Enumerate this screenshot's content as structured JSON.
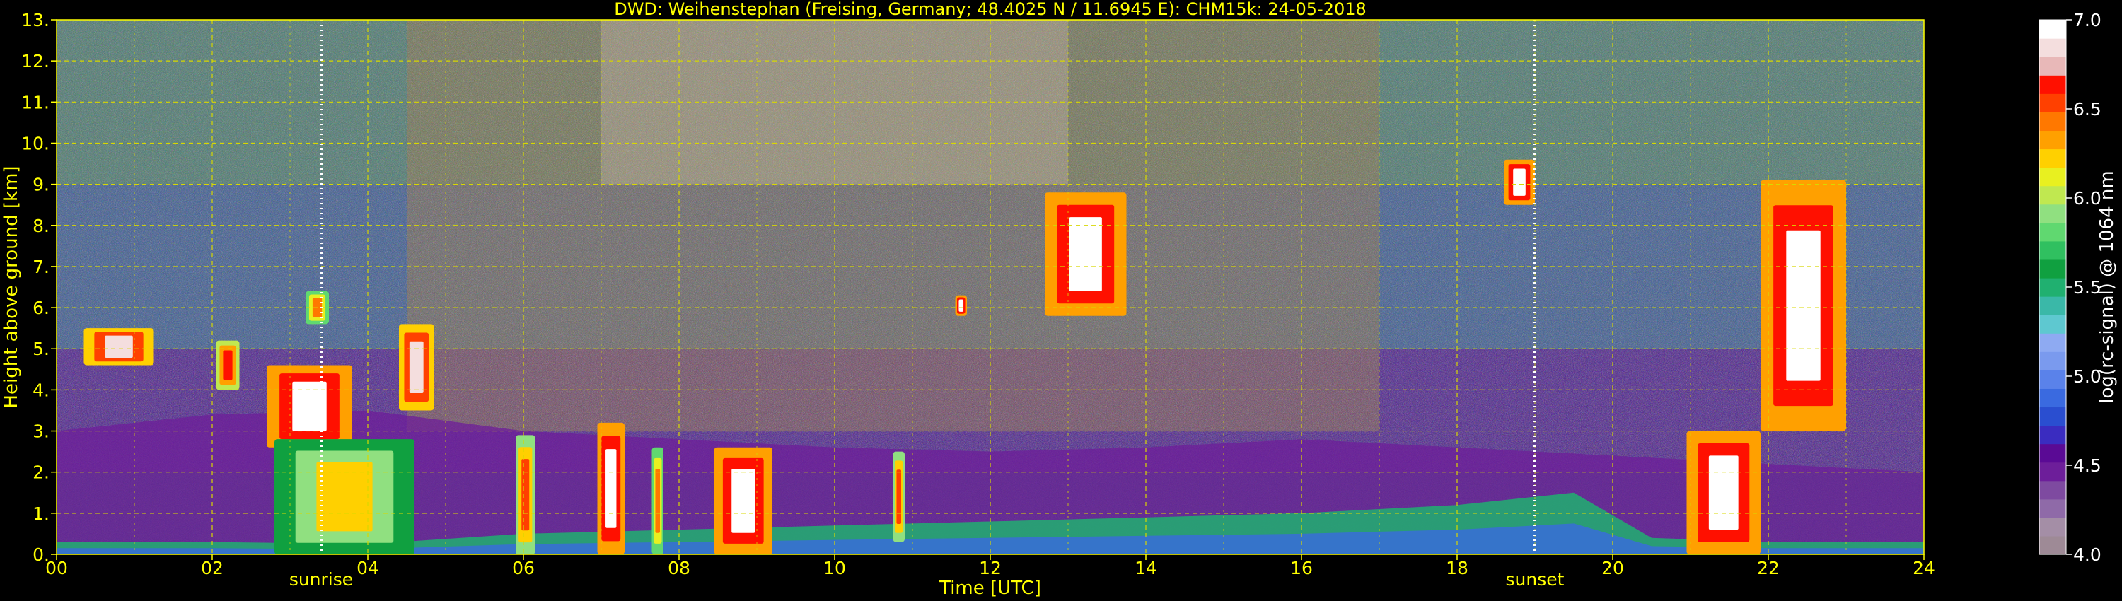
{
  "chart_data": {
    "type": "heatmap",
    "title": "DWD: Weihenstephan (Freising, Germany; 48.4025 N / 11.6945 E):    CHM15k: 24-05-2018",
    "xlabel": "Time [UTC]",
    "ylabel": "Height above ground [km]",
    "xlim": [
      0,
      24
    ],
    "ylim": [
      0,
      13
    ],
    "x_ticks": [
      {
        "value": 0,
        "label": "00"
      },
      {
        "value": 2,
        "label": "02"
      },
      {
        "value": 4,
        "label": "04"
      },
      {
        "value": 6,
        "label": "06"
      },
      {
        "value": 8,
        "label": "08"
      },
      {
        "value": 10,
        "label": "10"
      },
      {
        "value": 12,
        "label": "12"
      },
      {
        "value": 14,
        "label": "14"
      },
      {
        "value": 16,
        "label": "16"
      },
      {
        "value": 18,
        "label": "18"
      },
      {
        "value": 20,
        "label": "20"
      },
      {
        "value": 22,
        "label": "22"
      },
      {
        "value": 24,
        "label": "24"
      }
    ],
    "y_ticks": [
      {
        "value": 0,
        "label": "0."
      },
      {
        "value": 1,
        "label": "1."
      },
      {
        "value": 2,
        "label": "2."
      },
      {
        "value": 3,
        "label": "3."
      },
      {
        "value": 4,
        "label": "4."
      },
      {
        "value": 5,
        "label": "5."
      },
      {
        "value": 6,
        "label": "6."
      },
      {
        "value": 7,
        "label": "7."
      },
      {
        "value": 8,
        "label": "8."
      },
      {
        "value": 9,
        "label": "9."
      },
      {
        "value": 10,
        "label": "10."
      },
      {
        "value": 11,
        "label": "11."
      },
      {
        "value": 12,
        "label": "12."
      },
      {
        "value": 13,
        "label": "13."
      }
    ],
    "grid": true,
    "annotations": [
      {
        "label": "sunrise",
        "time": 3.4
      },
      {
        "label": "sunset",
        "time": 19.0
      }
    ],
    "colorbar": {
      "label": "log(rc-signal) @ 1064 nm",
      "range": [
        4.0,
        7.0
      ],
      "ticks": [
        {
          "value": 4.0,
          "label": "4.0"
        },
        {
          "value": 4.5,
          "label": "4.5"
        },
        {
          "value": 5.0,
          "label": "5.0"
        },
        {
          "value": 5.5,
          "label": "5.5"
        },
        {
          "value": 6.0,
          "label": "6.0"
        },
        {
          "value": 6.5,
          "label": "6.5"
        },
        {
          "value": 7.0,
          "label": "7.0"
        }
      ],
      "colors": [
        "#9e8a96",
        "#a48ea6",
        "#8f6aa8",
        "#7e4aa0",
        "#6d1e9a",
        "#5a0a95",
        "#3a2cc0",
        "#2a4ed0",
        "#3a6ae0",
        "#5a82ea",
        "#7a9aee",
        "#8eaaf2",
        "#5ec8d0",
        "#3ab8a8",
        "#20b070",
        "#10a040",
        "#30c060",
        "#60d870",
        "#90e080",
        "#c0e850",
        "#e8f020",
        "#ffd000",
        "#ffa000",
        "#ff7800",
        "#ff4000",
        "#ff1000",
        "#e8b8b8",
        "#f4dede",
        "#ffffff"
      ]
    },
    "features": {
      "boundary_layer": [
        {
          "t": 0.0,
          "h": 0.3
        },
        {
          "t": 2.0,
          "h": 0.3
        },
        {
          "t": 4.0,
          "h": 0.25
        },
        {
          "t": 6.0,
          "h": 0.5
        },
        {
          "t": 8.0,
          "h": 0.6
        },
        {
          "t": 10.0,
          "h": 0.7
        },
        {
          "t": 12.0,
          "h": 0.8
        },
        {
          "t": 14.0,
          "h": 0.9
        },
        {
          "t": 16.0,
          "h": 1.0
        },
        {
          "t": 18.0,
          "h": 1.2
        },
        {
          "t": 19.5,
          "h": 1.5
        },
        {
          "t": 20.5,
          "h": 0.4
        },
        {
          "t": 22.0,
          "h": 0.3
        },
        {
          "t": 24.0,
          "h": 0.3
        }
      ],
      "residual_layer": [
        {
          "t": 0.0,
          "h": 3.0
        },
        {
          "t": 2.0,
          "h": 3.4
        },
        {
          "t": 4.0,
          "h": 3.5
        },
        {
          "t": 6.0,
          "h": 3.0
        },
        {
          "t": 8.0,
          "h": 2.8
        },
        {
          "t": 10.0,
          "h": 2.6
        },
        {
          "t": 12.0,
          "h": 2.5
        },
        {
          "t": 14.0,
          "h": 2.6
        },
        {
          "t": 16.0,
          "h": 2.8
        },
        {
          "t": 18.0,
          "h": 2.6
        },
        {
          "t": 20.0,
          "h": 2.4
        },
        {
          "t": 22.0,
          "h": 2.2
        },
        {
          "t": 24.0,
          "h": 2.0
        }
      ],
      "clouds": [
        {
          "t0": 0.35,
          "t1": 1.25,
          "h0": 4.6,
          "h1": 5.5,
          "intensity": 6.8
        },
        {
          "t0": 2.05,
          "t1": 2.35,
          "h0": 4.0,
          "h1": 5.2,
          "intensity": 6.6
        },
        {
          "t0": 2.7,
          "t1": 3.8,
          "h0": 2.6,
          "h1": 4.6,
          "intensity": 6.9
        },
        {
          "t0": 3.2,
          "t1": 3.5,
          "h0": 5.6,
          "h1": 6.4,
          "intensity": 6.4
        },
        {
          "t0": 4.4,
          "t1": 4.85,
          "h0": 3.5,
          "h1": 5.6,
          "intensity": 6.8
        },
        {
          "t0": 2.8,
          "t1": 4.6,
          "h0": 0.0,
          "h1": 2.8,
          "intensity": 6.2
        },
        {
          "t0": 5.9,
          "t1": 6.15,
          "h0": 0.0,
          "h1": 2.9,
          "intensity": 6.5
        },
        {
          "t0": 6.95,
          "t1": 7.3,
          "h0": 0.0,
          "h1": 3.2,
          "intensity": 6.9
        },
        {
          "t0": 7.65,
          "t1": 7.8,
          "h0": 0.0,
          "h1": 2.6,
          "intensity": 6.4
        },
        {
          "t0": 8.45,
          "t1": 9.2,
          "h0": 0.0,
          "h1": 2.6,
          "intensity": 6.9
        },
        {
          "t0": 10.75,
          "t1": 10.9,
          "h0": 0.3,
          "h1": 2.5,
          "intensity": 6.5
        },
        {
          "t0": 11.55,
          "t1": 11.7,
          "h0": 5.8,
          "h1": 6.3,
          "intensity": 6.9
        },
        {
          "t0": 12.7,
          "t1": 13.75,
          "h0": 5.8,
          "h1": 8.8,
          "intensity": 6.9
        },
        {
          "t0": 18.6,
          "t1": 19.0,
          "h0": 8.5,
          "h1": 9.6,
          "intensity": 6.9
        },
        {
          "t0": 20.95,
          "t1": 21.9,
          "h0": 0.0,
          "h1": 3.0,
          "intensity": 6.9
        },
        {
          "t0": 21.9,
          "t1": 23.0,
          "h0": 3.0,
          "h1": 9.1,
          "intensity": 6.9
        }
      ]
    }
  }
}
